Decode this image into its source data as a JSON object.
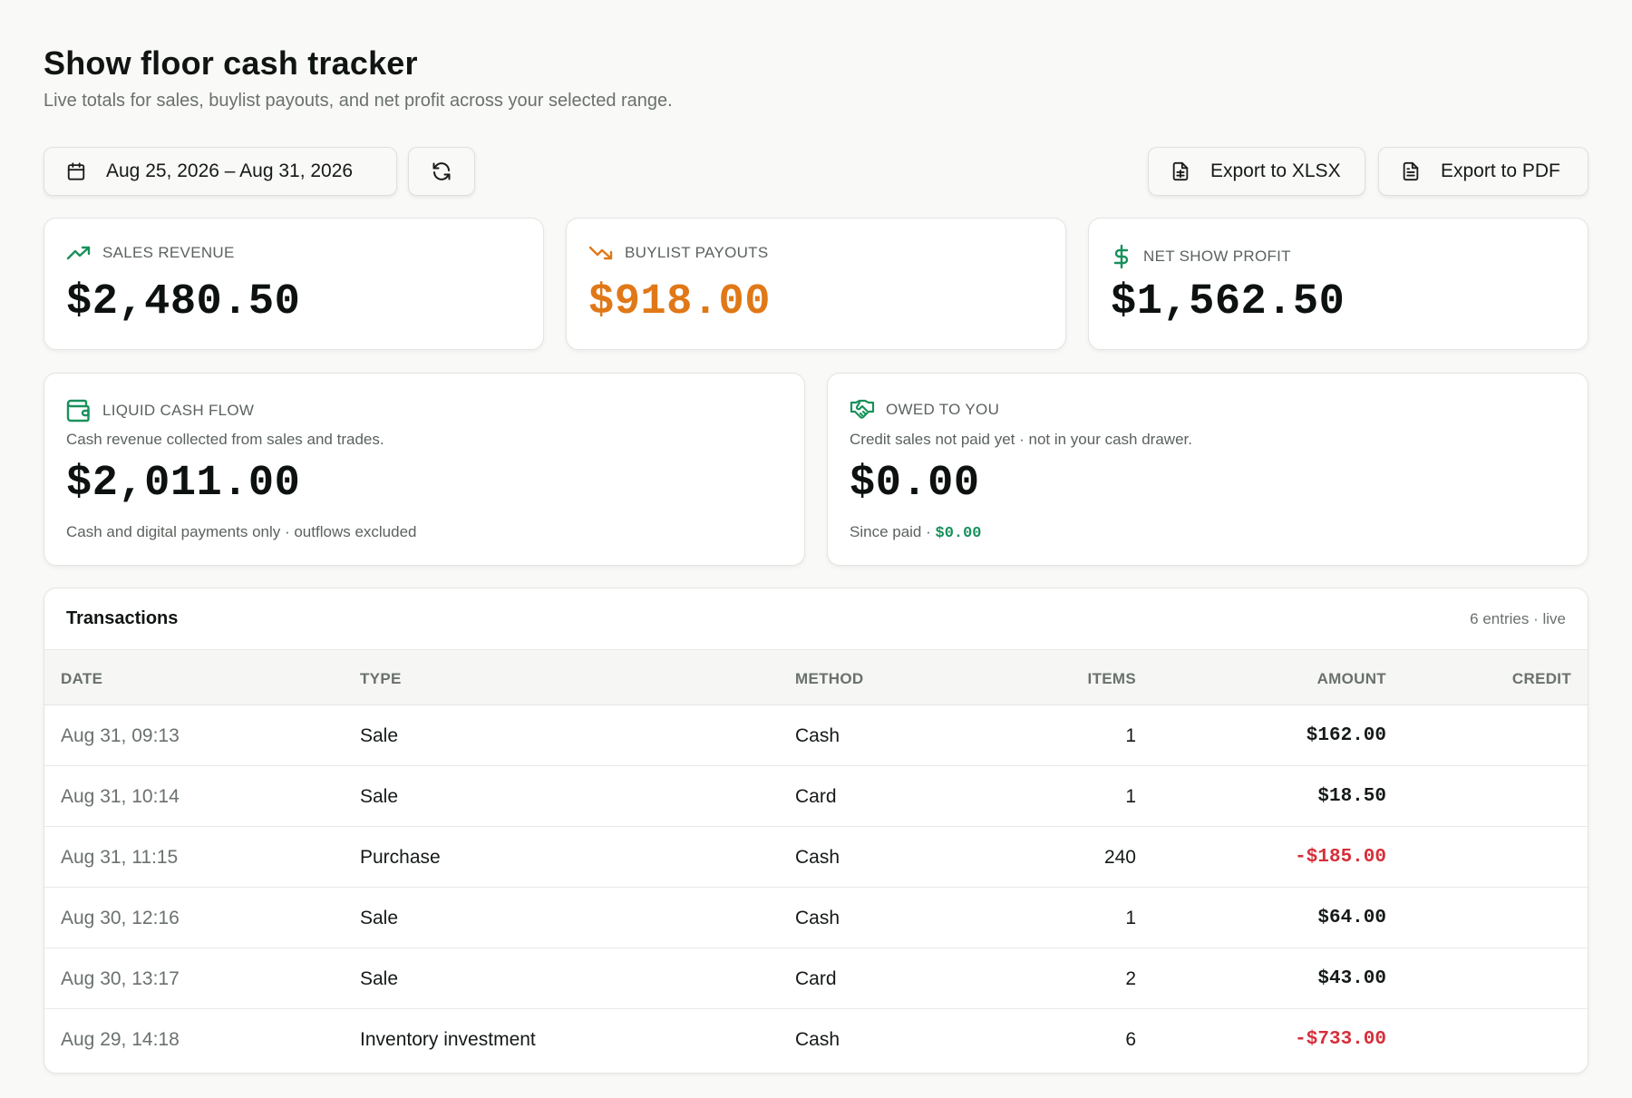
{
  "header": {
    "title": "Show floor cash tracker",
    "subtitle": "Live totals for sales, buylist payouts, and net profit across your selected range."
  },
  "toolbar": {
    "date_range": "Aug 25, 2026 – Aug 31, 2026",
    "export_xlsx": "Export to XLSX",
    "export_pdf": "Export to PDF",
    "icons": [
      "calendar-icon",
      "refresh-icon",
      "file-spreadsheet-icon",
      "file-text-icon"
    ]
  },
  "stats": {
    "sales_revenue": {
      "label": "SALES REVENUE",
      "value": "$2,480.50",
      "icon": "trending-up-icon"
    },
    "buylist_payouts": {
      "label": "BUYLIST PAYOUTS",
      "value": "$918.00",
      "icon": "trending-down-icon"
    },
    "net_profit": {
      "label": "NET SHOW PROFIT",
      "value": "$1,562.50",
      "icon": "dollar-icon"
    }
  },
  "liquid": {
    "label": "LIQUID CASH FLOW",
    "description": "Cash revenue collected from sales and trades.",
    "value": "$2,011.00",
    "note": "Cash and digital payments only · outflows excluded",
    "icon": "wallet-icon"
  },
  "owed": {
    "label": "OWED TO YOU",
    "description": "Credit sales not paid yet · not in your cash drawer.",
    "value": "$0.00",
    "since_paid_label": "Since paid · ",
    "since_paid_value": "$0.00",
    "icon": "handshake-icon"
  },
  "transactions": {
    "title": "Transactions",
    "meta": "6 entries · live",
    "columns": {
      "date": "DATE",
      "type": "TYPE",
      "method": "METHOD",
      "items": "ITEMS",
      "amount": "AMOUNT",
      "credit": "CREDIT"
    },
    "rows": [
      {
        "date": "Aug 31, 09:13",
        "type": "Sale",
        "method": "Cash",
        "items": "1",
        "amount": "$162.00",
        "credit": ""
      },
      {
        "date": "Aug 31, 10:14",
        "type": "Sale",
        "method": "Card",
        "items": "1",
        "amount": "$18.50",
        "credit": ""
      },
      {
        "date": "Aug 31, 11:15",
        "type": "Purchase",
        "method": "Cash",
        "items": "240",
        "amount": "-$185.00",
        "credit": ""
      },
      {
        "date": "Aug 30, 12:16",
        "type": "Sale",
        "method": "Cash",
        "items": "1",
        "amount": "$64.00",
        "credit": ""
      },
      {
        "date": "Aug 30, 13:17",
        "type": "Sale",
        "method": "Card",
        "items": "2",
        "amount": "$43.00",
        "credit": ""
      },
      {
        "date": "Aug 29, 14:18",
        "type": "Inventory investment",
        "method": "Cash",
        "items": "6",
        "amount": "-$733.00",
        "credit": ""
      }
    ]
  },
  "colors": {
    "accent_green": "#18915b",
    "accent_orange": "#e07818",
    "negative_red": "#d62f3a",
    "text_dark": "#101513",
    "text_muted": "#6a716d"
  }
}
